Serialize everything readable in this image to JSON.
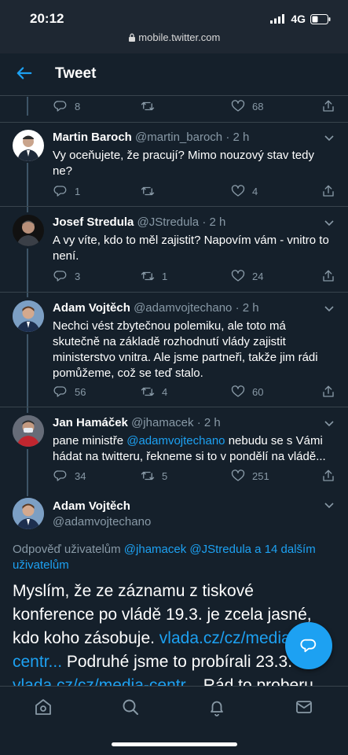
{
  "status": {
    "time": "20:12",
    "network": "4G",
    "url": "mobile.twitter.com"
  },
  "header": {
    "title": "Tweet"
  },
  "top_actions": {
    "reply_count": "8",
    "like_count": "68"
  },
  "tweets": [
    {
      "name": "Martin Baroch",
      "handle": "@martin_baroch",
      "time": "· 2 h",
      "text": "Vy oceňujete, že pracují? Mimo nouzový stav tedy ne?",
      "replies": "1",
      "retweets": "",
      "likes": "4"
    },
    {
      "name": "Josef Stredula",
      "handle": "@JStredula",
      "time": "· 2 h",
      "text": "A vy víte, kdo to měl zajistit? Napovím vám - vnitro to není.",
      "replies": "3",
      "retweets": "1",
      "likes": "24"
    },
    {
      "name": "Adam Vojtěch",
      "handle": "@adamvojtechano",
      "time": "· 2 h",
      "text": "Nechci vést zbytečnou polemiku, ale toto má skutečně na základě rozhodnutí vlády zajistit ministerstvo vnitra. Ale jsme partneři, takže jim rádi pomůžeme, což se teď stalo.",
      "replies": "56",
      "retweets": "4",
      "likes": "60"
    },
    {
      "name": "Jan Hamáček",
      "handle": "@jhamacek",
      "time": "· 2 h",
      "text_pre": "pane ministře ",
      "text_mention": "@adamvojtechano",
      "text_post": " nebudu se s Vámi hádat na twitteru, řekneme si to v pondělí na vládě...",
      "replies": "34",
      "retweets": "5",
      "likes": "251"
    }
  ],
  "main_tweet": {
    "name": "Adam Vojtěch",
    "handle": "@adamvojtechano",
    "reply_prefix": "Odpověď uživatelům ",
    "reply_user1": "@jhamacek",
    "reply_user2": "@JStredula",
    "reply_others": " a 14 dalším uživatelům",
    "text_1": "Myslím, že ze záznamu z tiskové konference po vládě 19.3. je zcela jasné, kdo koho zásobuje. ",
    "link_1": "vlada.cz/cz/media-centr...",
    "text_2": " Podruhé jsme to probírali 23.3. ",
    "link_2": "vlada.cz/cz/media-centr...",
    "text_3": " Rád to proberu"
  },
  "colors": {
    "background": "#15202b",
    "accent": "#1da1f2",
    "muted": "#8899a6",
    "divider": "#38444d"
  },
  "icons": [
    "back-arrow-icon",
    "reply-icon",
    "retweet-icon",
    "like-icon",
    "share-icon",
    "chevron-down-icon",
    "compose-reply-icon",
    "home-icon",
    "search-icon",
    "notifications-icon",
    "messages-icon",
    "lock-icon",
    "signal-icon",
    "battery-icon"
  ]
}
